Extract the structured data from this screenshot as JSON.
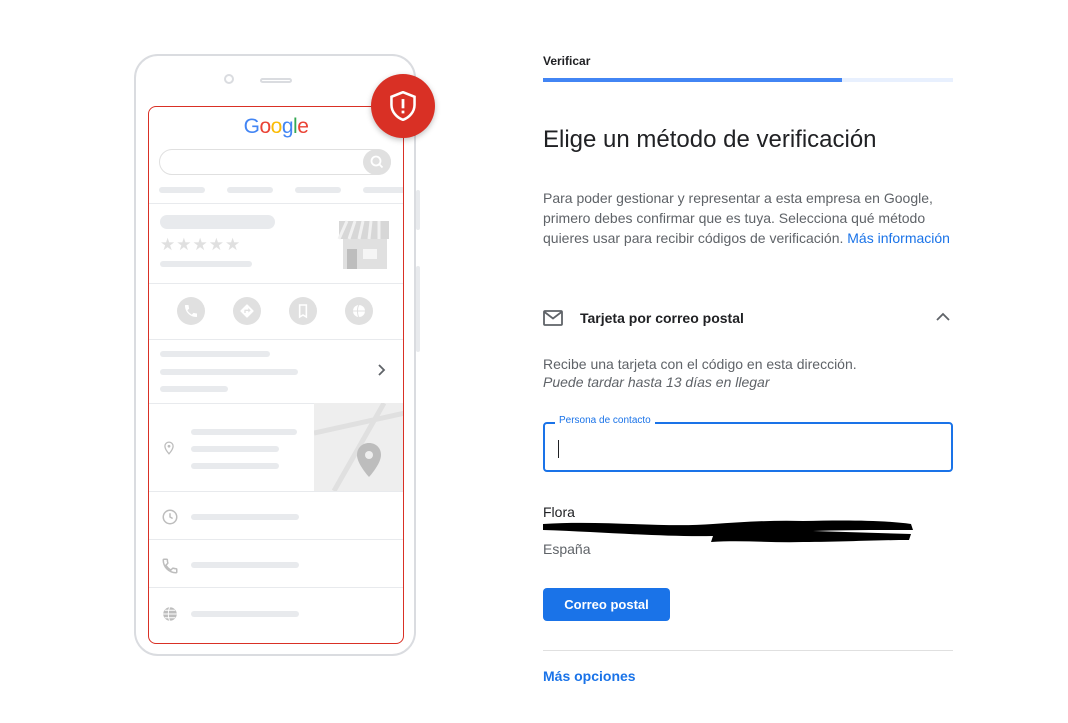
{
  "illustration": {
    "google_logo": [
      {
        "ch": "G",
        "color": "#4285f4"
      },
      {
        "ch": "o",
        "color": "#ea4335"
      },
      {
        "ch": "o",
        "color": "#fbbc05"
      },
      {
        "ch": "g",
        "color": "#4285f4"
      },
      {
        "ch": "l",
        "color": "#34a853"
      },
      {
        "ch": "e",
        "color": "#ea4335"
      }
    ],
    "stars": "★★★★★",
    "accent_color": "#d93025",
    "icons": [
      "phone-icon",
      "directions-icon",
      "bookmark-icon",
      "globe-icon",
      "location-icon",
      "clock-icon",
      "phone-icon",
      "globe-icon",
      "shield-alert-icon"
    ]
  },
  "header": {
    "step_label": "Verificar",
    "progress_fraction": 0.73
  },
  "main": {
    "title": "Elige un método de verificación",
    "description": "Para poder gestionar y representar a esta empresa en Google, primero debes confirmar que es tuya. Selecciona qué método quieres usar para recibir códigos de verificación.",
    "more_info_link": "Más información"
  },
  "method": {
    "icon": "mail-icon",
    "title": "Tarjeta por correo postal",
    "expand_icon": "chevron-up-icon",
    "card_text": "Recibe una tarjeta con el código en esta dirección.",
    "card_note": "Puede tardar hasta 13 días en llegar",
    "contact_field": {
      "label": "Persona de contacto",
      "value": "",
      "placeholder": ""
    },
    "address": {
      "name": "Flora",
      "country": "España"
    },
    "submit_label": "Correo postal"
  },
  "footer": {
    "more_options_label": "Más opciones"
  },
  "colors": {
    "primary": "#1a73e8",
    "progress": "#4285f4",
    "text": "#202124",
    "muted": "#5f6368"
  }
}
